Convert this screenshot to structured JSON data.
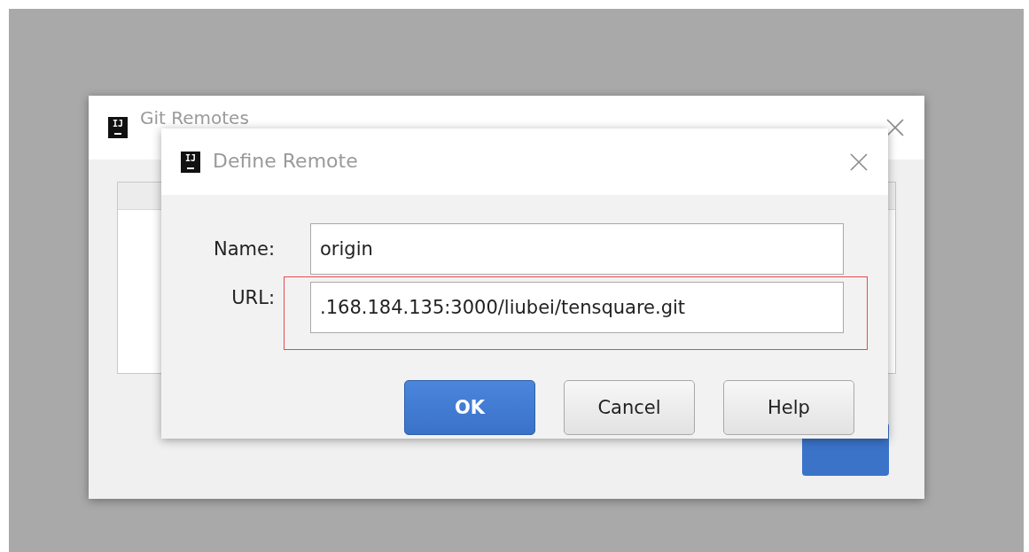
{
  "background_window": {
    "logo": "IJ",
    "title": "Git Remotes"
  },
  "dialog": {
    "logo": "IJ",
    "title": "Define Remote",
    "fields": [
      {
        "label": "Name:",
        "value": "origin",
        "highlighted": false
      },
      {
        "label": "URL:",
        "value": ".168.184.135:3000/liubei/tensquare.git",
        "highlighted": true
      }
    ],
    "buttons": [
      {
        "label": "OK",
        "kind": "primary"
      },
      {
        "label": "Cancel",
        "kind": "secondary"
      },
      {
        "label": "Help",
        "kind": "secondary"
      }
    ]
  }
}
